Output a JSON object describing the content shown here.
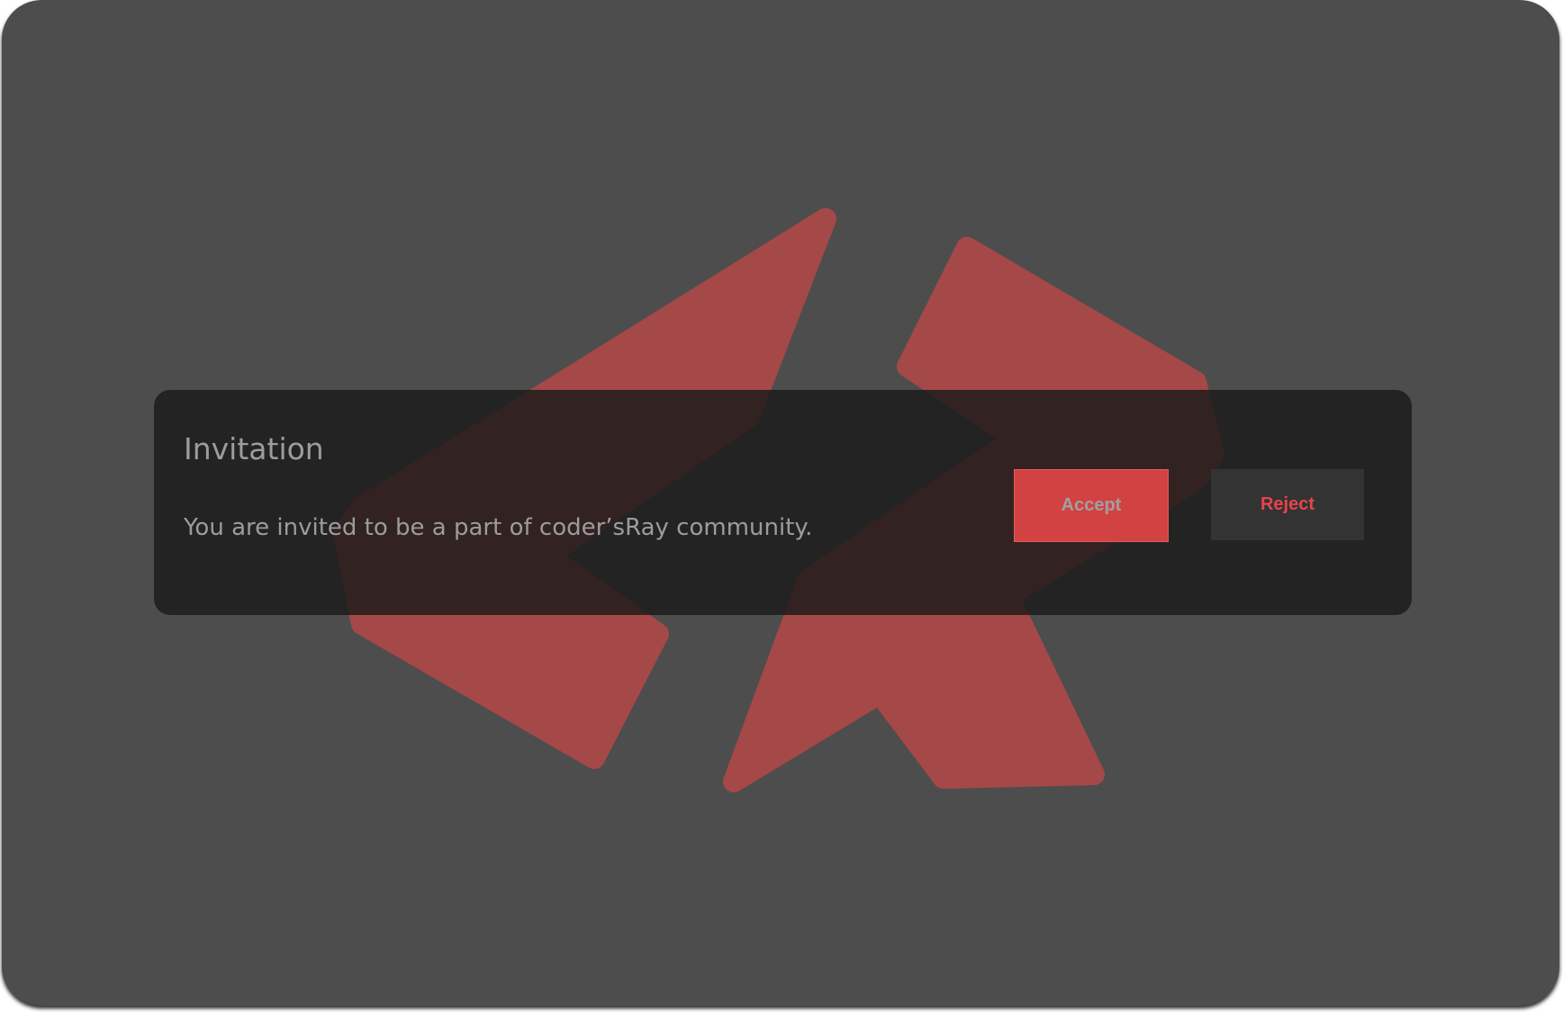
{
  "dialog": {
    "title": "Invitation",
    "message": "You are invited to be a part of coder’sRay community.",
    "accept_label": "Accept",
    "reject_label": "Reject"
  },
  "logo": {
    "icon": "coders-ray-logo-icon",
    "color": "#a54848"
  },
  "colors": {
    "background": "#4d4d4d",
    "dialog": "#262626",
    "accent": "#d24242",
    "reject_text": "#e5444d"
  }
}
